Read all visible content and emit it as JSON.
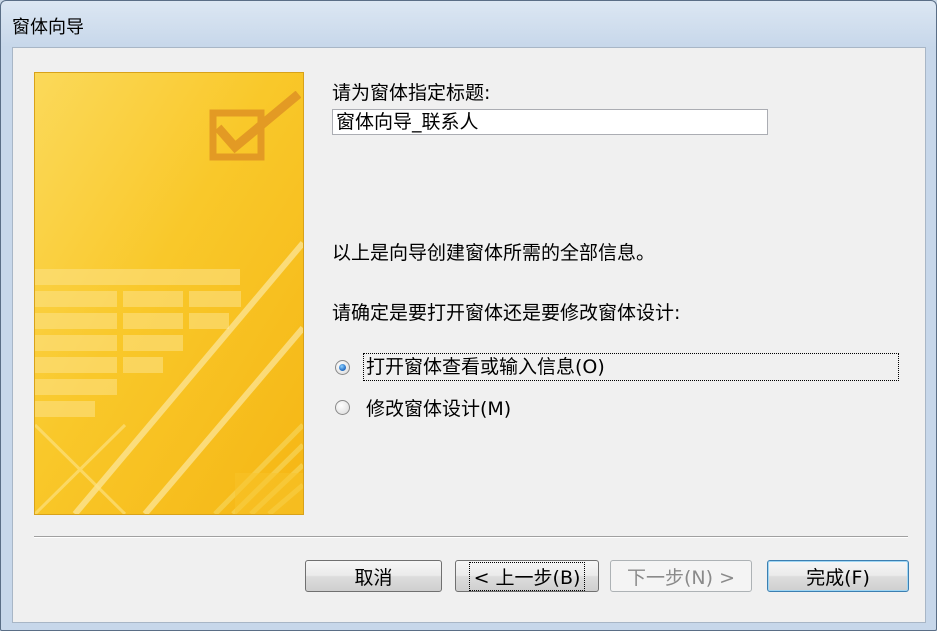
{
  "window": {
    "title": "窗体向导"
  },
  "form": {
    "title_prompt": "请为窗体指定标题:",
    "title_value": "窗体向导_联系人",
    "info_text": "以上是向导创建窗体所需的全部信息。",
    "choice_prompt": "请确定是要打开窗体还是要修改窗体设计:",
    "options": [
      {
        "label": "打开窗体查看或输入信息(O)",
        "checked": true
      },
      {
        "label": "修改窗体设计(M)",
        "checked": false
      }
    ]
  },
  "buttons": {
    "cancel": "取消",
    "back": "< 上一步(B)",
    "next": "下一步(N) >",
    "finish": "完成(F)"
  },
  "colors": {
    "image_gold": "#f9c21a",
    "image_light": "#fde7a0",
    "checkbox_orange": "#e59a1c"
  },
  "icons": {
    "side_checkbox": "checkbox-checked-icon"
  }
}
